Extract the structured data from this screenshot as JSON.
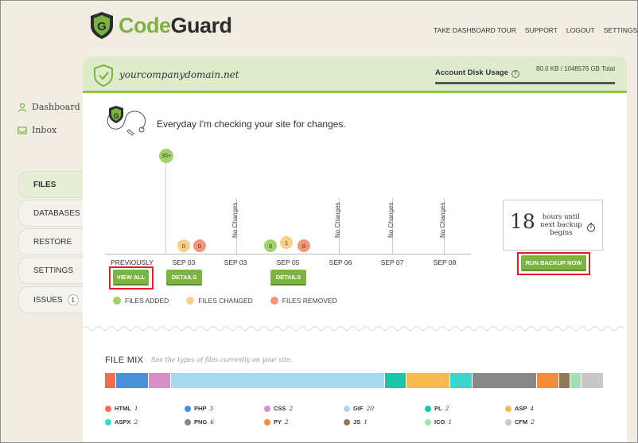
{
  "header": {
    "logo_code": "Code",
    "logo_guard": "Guard",
    "nav": [
      "TAKE DASHBOARD TOUR",
      "SUPPORT",
      "LOGOUT",
      "SETTINGS"
    ]
  },
  "sidebar": {
    "links": [
      {
        "label": "Dashboard",
        "icon": "user-icon"
      },
      {
        "label": "Inbox",
        "icon": "inbox-icon"
      }
    ],
    "tabs": [
      {
        "label": "FILES",
        "active": true
      },
      {
        "label": "DATABASES"
      },
      {
        "label": "RESTORE"
      },
      {
        "label": "SETTINGS"
      },
      {
        "label": "ISSUES",
        "count": "1"
      }
    ]
  },
  "site": {
    "name": "yourcompanydomain.net",
    "disk_label": "Account Disk Usage",
    "disk_help": "?",
    "disk_value": "80.0 KB / 1048576 GB Total"
  },
  "status_text": "Everyday I'm checking your site for changes.",
  "timeline": {
    "top_badge": "30+",
    "labels": [
      "PREVIOUSLY",
      "SEP 03",
      "SEP 03",
      "SEP 05",
      "SEP 06",
      "SEP 07",
      "SEP 08"
    ],
    "no_changes": "No Changes",
    "sep03a": {
      "changed": "0",
      "removed": "0"
    },
    "sep05": {
      "added": "0",
      "changed": "1",
      "removed": "0"
    },
    "view_all": "VIEW ALL",
    "details": "DETAILS"
  },
  "legend": {
    "added": "FILES ADDED",
    "changed": "FILES CHANGED",
    "removed": "FILES REMOVED"
  },
  "backup": {
    "hours": "18",
    "line1": "hours until",
    "line2": "next backup",
    "line3": "begins",
    "run_button": "RUN BACKUP NOW"
  },
  "file_mix": {
    "title": "FILE MIX",
    "subtitle": "See the types of files currently on your site.",
    "segments": [
      {
        "color": "#f26d4f",
        "weight": 1
      },
      {
        "color": "#4a90d9",
        "weight": 3
      },
      {
        "color": "#d88fc6",
        "weight": 2
      },
      {
        "color": "#a6d8f0",
        "weight": 20
      },
      {
        "color": "#1bc6a6",
        "weight": 2
      },
      {
        "color": "#f7b94f",
        "weight": 4
      },
      {
        "color": "#3ad6cc",
        "weight": 2
      },
      {
        "color": "#888888",
        "weight": 6
      },
      {
        "color": "#f58a3c",
        "weight": 2
      },
      {
        "color": "#8e7a5a",
        "weight": 1
      },
      {
        "color": "#a3e0b8",
        "weight": 1
      },
      {
        "color": "#c8c8c8",
        "weight": 2
      }
    ],
    "types": [
      {
        "name": "HTML",
        "count": "1",
        "color": "#f26d4f"
      },
      {
        "name": "PHP",
        "count": "3",
        "color": "#4a90d9"
      },
      {
        "name": "CSS",
        "count": "2",
        "color": "#d88fc6"
      },
      {
        "name": "GIF",
        "count": "20",
        "color": "#a6d8f0"
      },
      {
        "name": "PL",
        "count": "2",
        "color": "#1bc6a6"
      },
      {
        "name": "ASP",
        "count": "4",
        "color": "#f7b94f"
      },
      {
        "name": "ASPX",
        "count": "2",
        "color": "#3ad6cc"
      },
      {
        "name": "PNG",
        "count": "6",
        "color": "#888888"
      },
      {
        "name": "PY",
        "count": "2",
        "color": "#f58a3c"
      },
      {
        "name": "JS",
        "count": "1",
        "color": "#8e7a5a"
      },
      {
        "name": "ICO",
        "count": "1",
        "color": "#a3e0b8"
      },
      {
        "name": "CFM",
        "count": "2",
        "color": "#c8c8c8"
      }
    ]
  }
}
